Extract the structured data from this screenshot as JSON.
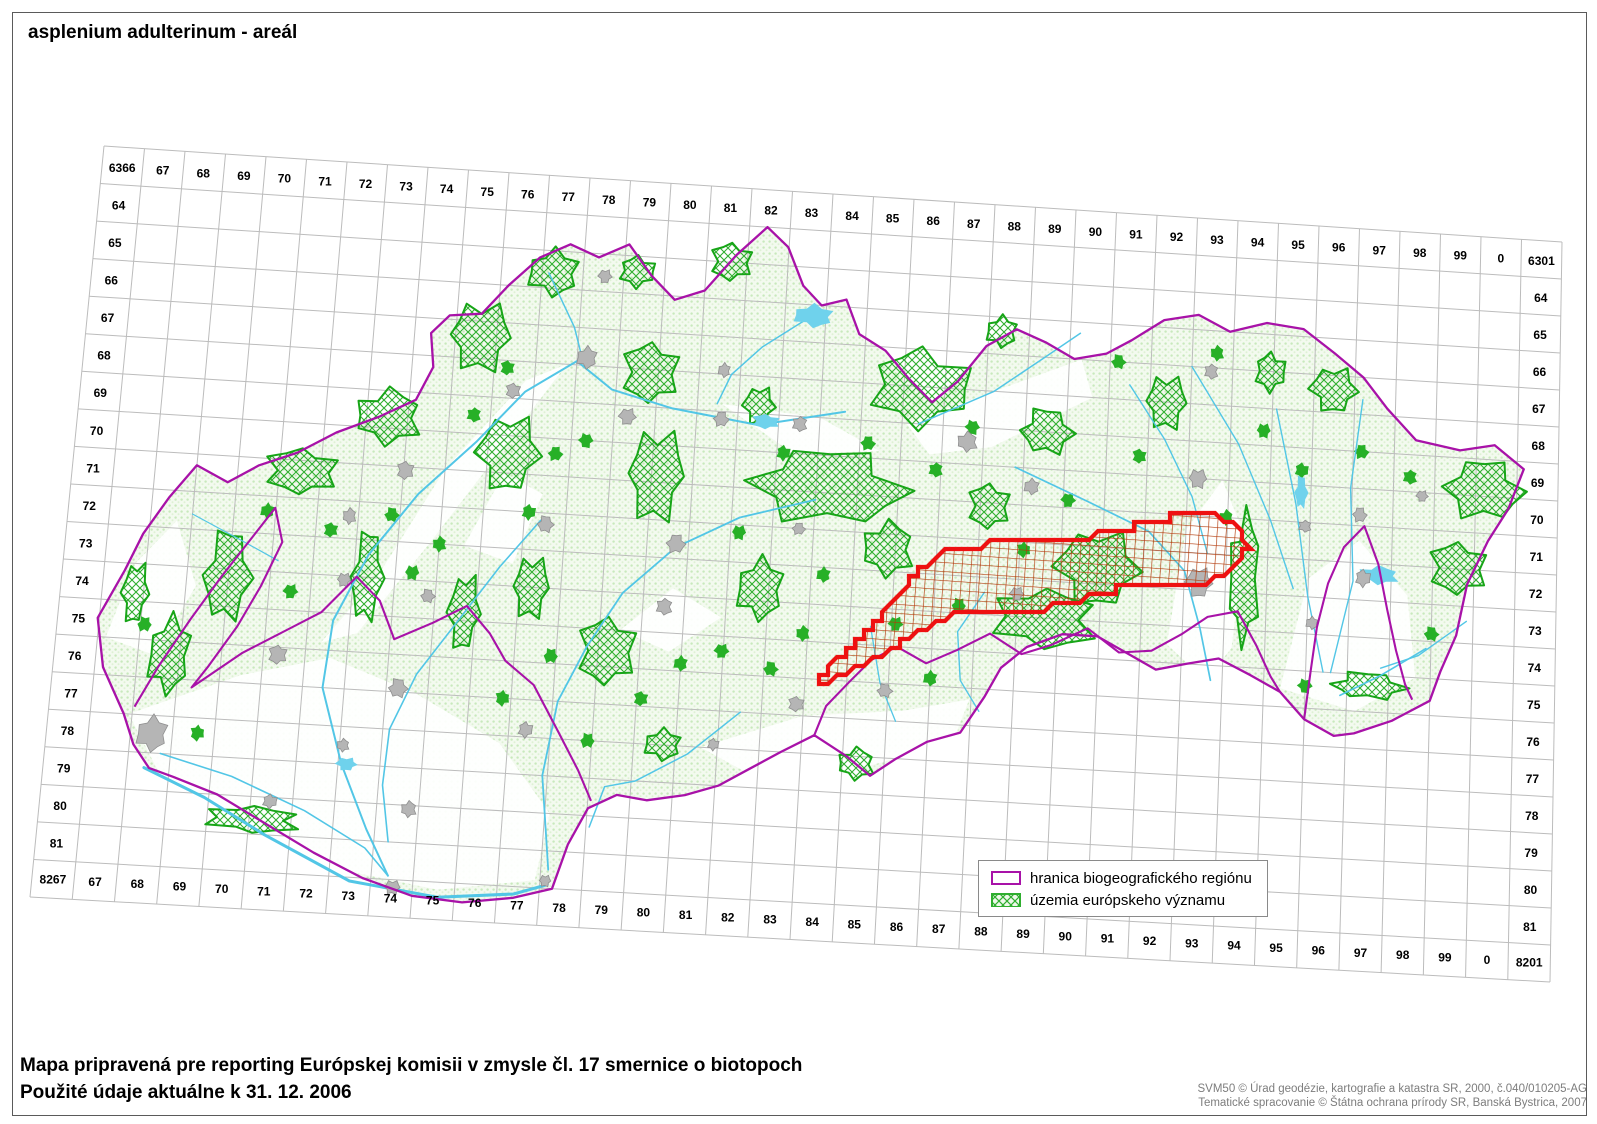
{
  "title": "asplenium adulterinum - areál",
  "legend": {
    "items": [
      {
        "label": "hranica biogeografického regiónu",
        "type": "boundary-swatch"
      },
      {
        "label": "územia európskeho významu",
        "type": "sci-swatch"
      }
    ]
  },
  "footer": {
    "line1": "Mapa pripravená pre reporting Európskej komisii v zmysle čl. 17 smernice o biotopoch",
    "line2": "Použité údaje aktuálne k 31. 12. 2006"
  },
  "credits": {
    "line1": "SVM50 © Úrad geodézie, kartografie a katastra SR, 2000, č.040/010205-AG",
    "line2": "Tematické spracovanie © Štátna ochrana prírody SR, Banská Bystrica, 2007"
  },
  "grid": {
    "top": [
      "6366",
      "67",
      "68",
      "69",
      "70",
      "71",
      "72",
      "73",
      "74",
      "75",
      "76",
      "77",
      "78",
      "79",
      "80",
      "81",
      "82",
      "83",
      "84",
      "85",
      "86",
      "87",
      "88",
      "89",
      "90",
      "91",
      "92",
      "93",
      "94",
      "95",
      "96",
      "97",
      "98",
      "99",
      "0",
      "6301"
    ],
    "bottom": [
      "8267",
      "67",
      "68",
      "69",
      "70",
      "71",
      "72",
      "73",
      "74",
      "75",
      "76",
      "77",
      "78",
      "79",
      "80",
      "81",
      "82",
      "83",
      "84",
      "85",
      "86",
      "87",
      "88",
      "89",
      "90",
      "91",
      "92",
      "93",
      "94",
      "95",
      "96",
      "97",
      "98",
      "99",
      "0",
      "8201"
    ],
    "left": [
      "64",
      "65",
      "66",
      "67",
      "68",
      "69",
      "70",
      "71",
      "72",
      "73",
      "74",
      "75",
      "76",
      "77",
      "78",
      "79",
      "80",
      "81"
    ],
    "right": [
      "64",
      "65",
      "66",
      "67",
      "68",
      "69",
      "70",
      "71",
      "72",
      "73",
      "74",
      "75",
      "76",
      "77",
      "78",
      "79",
      "80",
      "81"
    ]
  },
  "colors": {
    "boundary_purple": "#a812a8",
    "sci_green": "#17a517",
    "sci_hatch": "#2fae2f",
    "range_red": "#ee1111",
    "range_hatch": "#b23a0a",
    "river_cyan": "#52c6e6",
    "lake_cyan": "#6fd2ec",
    "urban_gray": "#b5b5b5",
    "grid_gray": "#bcbcbc",
    "forest_dot": "#c8e9bc",
    "label_black": "#000000",
    "credits_gray": "#7d7d7d"
  }
}
